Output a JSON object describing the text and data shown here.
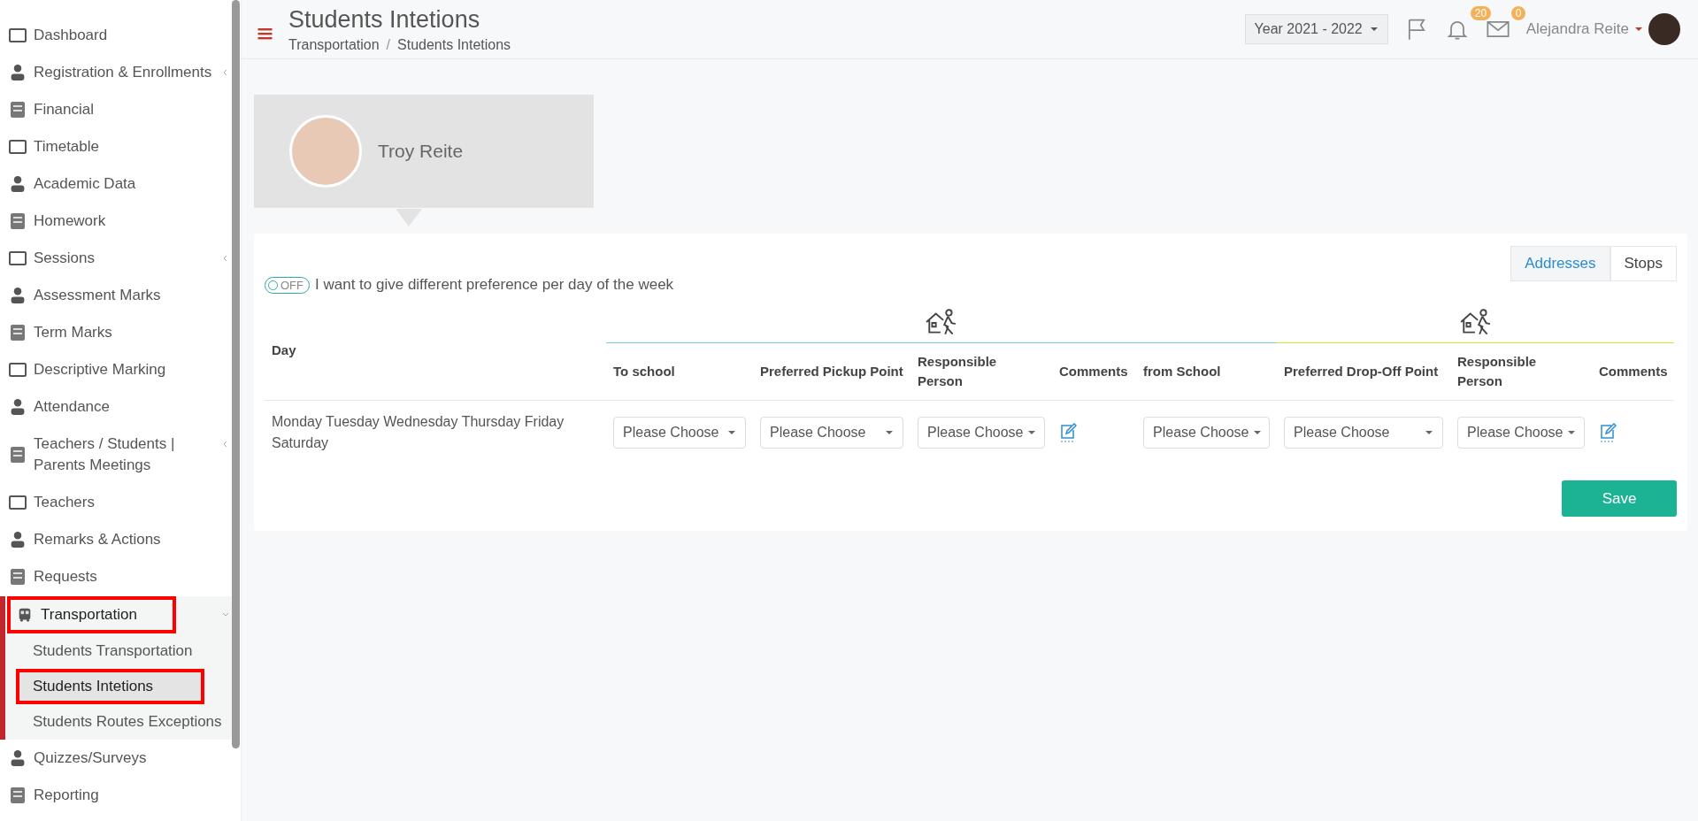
{
  "sidebar": {
    "items": [
      {
        "label": "Dashboard",
        "selected": false,
        "highlighted": false
      },
      {
        "label": "Registration & Enrollments",
        "selected": false,
        "highlighted": false,
        "expanded": false
      },
      {
        "label": "Financial",
        "selected": false,
        "highlighted": false
      },
      {
        "label": "Timetable",
        "selected": false,
        "highlighted": false
      },
      {
        "label": "Academic Data",
        "selected": false,
        "highlighted": false
      },
      {
        "label": "Homework",
        "selected": false,
        "highlighted": false
      },
      {
        "label": "Sessions",
        "selected": false,
        "highlighted": false,
        "expanded": false
      },
      {
        "label": "Assessment Marks",
        "selected": false,
        "highlighted": false
      },
      {
        "label": "Term Marks",
        "selected": false,
        "highlighted": false
      },
      {
        "label": "Descriptive Marking",
        "selected": false,
        "highlighted": false
      },
      {
        "label": "Attendance",
        "selected": false,
        "highlighted": false
      },
      {
        "label": "Teachers / Students | Parents Meetings",
        "selected": false,
        "highlighted": false,
        "expanded": false
      },
      {
        "label": "Teachers",
        "selected": false,
        "highlighted": false
      },
      {
        "label": "Remarks & Actions",
        "selected": false,
        "highlighted": false
      },
      {
        "label": "Requests",
        "selected": false,
        "highlighted": false
      },
      {
        "label": "Transportation",
        "selected": true,
        "highlighted": true,
        "expanded": true,
        "children": [
          {
            "label": "Students Transportation",
            "selected": false,
            "highlighted": false
          },
          {
            "label": "Students Intetions",
            "selected": true,
            "highlighted": true
          },
          {
            "label": "Students Routes Exceptions",
            "selected": false,
            "highlighted": false
          }
        ]
      },
      {
        "label": "Quizzes/Surveys",
        "selected": false,
        "highlighted": false
      },
      {
        "label": "Reporting",
        "selected": false,
        "highlighted": false
      }
    ]
  },
  "header": {
    "title": "Students Intetions",
    "breadcrumb": [
      "Transportation",
      "Students Intetions"
    ],
    "breadcrumb_separator": "/",
    "year_select": "Year 2021 - 2022",
    "notifications_badge": "20",
    "messages_badge": "0",
    "user_name": "Alejandra Reite"
  },
  "student_card": {
    "name": "Troy Reite"
  },
  "panel": {
    "tabs": [
      {
        "label": "Addresses",
        "selected": true
      },
      {
        "label": "Stops",
        "selected": false
      }
    ],
    "toggle": {
      "on": false,
      "label": "OFF",
      "text": "I want to give different preference per day of the week"
    },
    "table": {
      "day_column": "Day",
      "groups": [
        {
          "color": "#7dc8ec",
          "columns": [
            "To school",
            "Preferred Pickup Point",
            "Responsible Person",
            "Comments",
            "from School"
          ]
        },
        {
          "color": "#c6ee2a",
          "columns": [
            "Preferred Drop-Off Point",
            "Responsible Person",
            "Comments"
          ]
        }
      ],
      "rows": [
        {
          "cells": [
            {
              "kind": "text",
              "text": "Monday Tuesday Wednesday Thursday Friday Saturday"
            },
            {
              "kind": "select",
              "placeholder": "Please Choose"
            },
            {
              "kind": "select",
              "placeholder": "Please Choose"
            },
            {
              "kind": "select",
              "placeholder": "Please Choose"
            },
            {
              "kind": "comment"
            },
            {
              "kind": "select",
              "placeholder": "Please Choose"
            },
            {
              "kind": "select",
              "placeholder": "Please Choose"
            },
            {
              "kind": "select",
              "placeholder": "Please Choose"
            },
            {
              "kind": "comment"
            }
          ]
        }
      ]
    },
    "save_button": "Save"
  }
}
